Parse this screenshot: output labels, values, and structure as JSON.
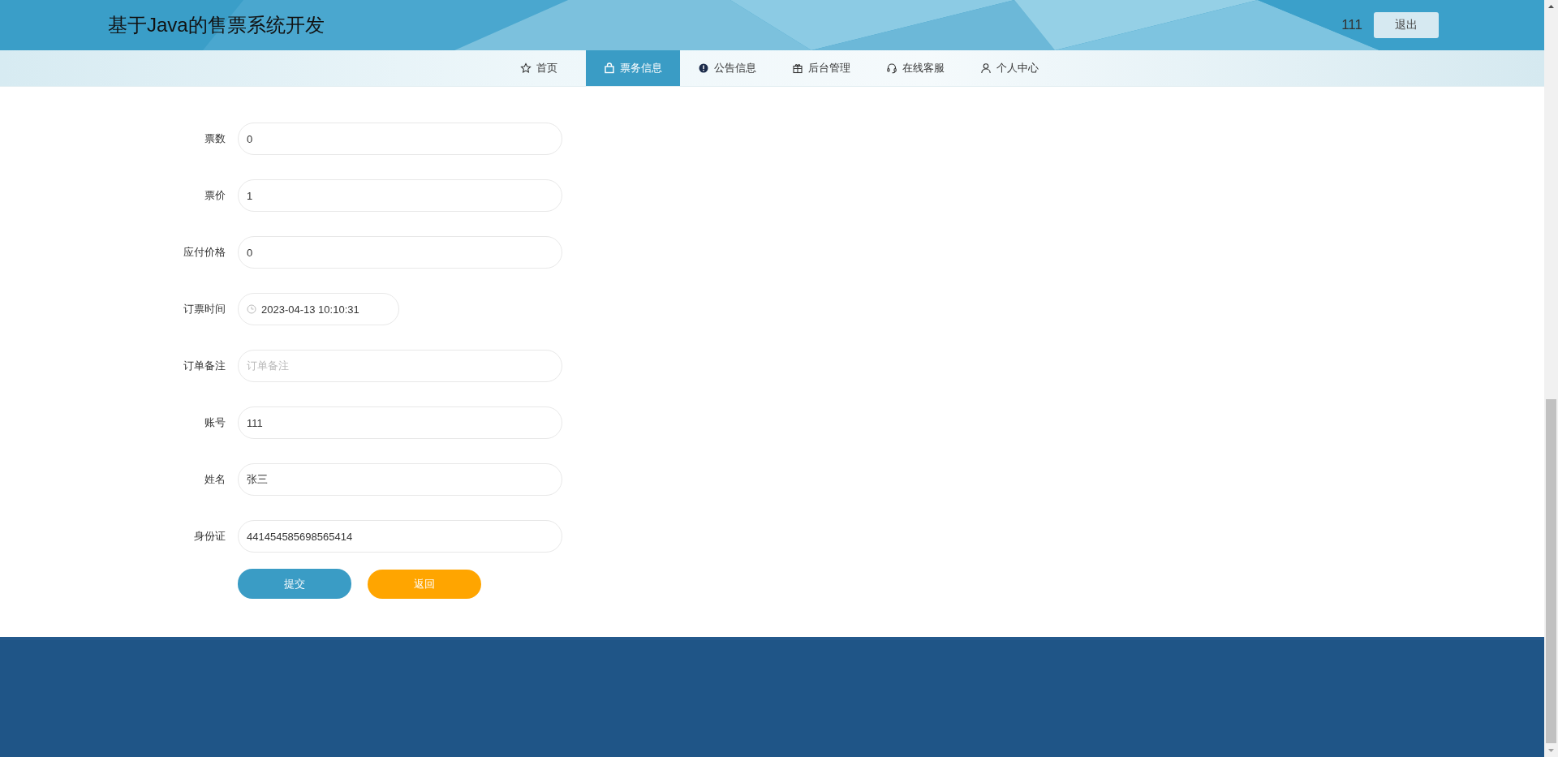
{
  "header": {
    "title": "基于Java的售票系统开发",
    "username": "111",
    "logout_button": "退出"
  },
  "nav": [
    {
      "label": "首页",
      "selected": false
    },
    {
      "label": "票务信息",
      "selected": true
    },
    {
      "label": "公告信息",
      "selected": false
    },
    {
      "label": "后台管理",
      "selected": false
    },
    {
      "label": "在线客服",
      "selected": false
    },
    {
      "label": "个人中心",
      "selected": false
    }
  ],
  "form": {
    "fields": [
      {
        "label": "票数",
        "kind": "text",
        "value": "0"
      },
      {
        "label": "票价",
        "kind": "text",
        "value": "1"
      },
      {
        "label": "应付价格",
        "kind": "text",
        "value": "0"
      },
      {
        "label": "订票时间",
        "kind": "date",
        "value": "2023-04-13 10:10:31"
      },
      {
        "label": "订单备注",
        "kind": "text",
        "placeholder": "订单备注"
      },
      {
        "label": "账号",
        "kind": "text",
        "value": "111"
      },
      {
        "label": "姓名",
        "kind": "text",
        "value": "张三"
      },
      {
        "label": "身份证",
        "kind": "text",
        "value": "441454585698565414"
      }
    ],
    "buttons": [
      {
        "label": "提交",
        "kind": "submit"
      },
      {
        "label": "返回",
        "kind": "back"
      }
    ]
  }
}
